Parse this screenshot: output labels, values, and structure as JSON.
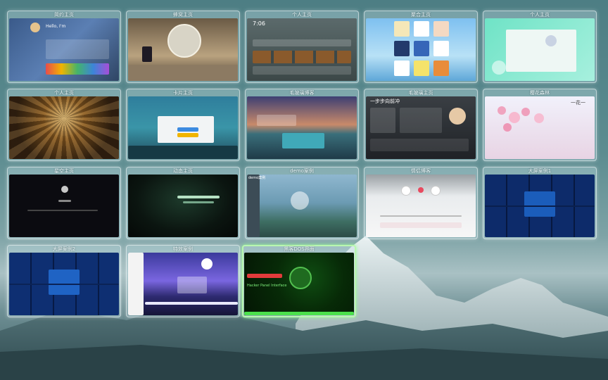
{
  "screen": {
    "cards": [
      {
        "title": "简约主页",
        "icon": "personal-homepage-preview",
        "accent": "#3c5c8f"
      },
      {
        "title": "蜂窝主页",
        "icon": "honeycomb-room-preview",
        "accent": "#8a7356"
      },
      {
        "title": "个人主页",
        "icon": "dashboard-preview",
        "accent": "#4b5b5c"
      },
      {
        "title": "聚合主页",
        "icon": "app-grid-preview",
        "accent": "#7cb7e0"
      },
      {
        "title": "个人主页",
        "icon": "profile-card-preview",
        "accent": "#7de0c8"
      },
      {
        "title": "个人主页",
        "icon": "cathedral-ceiling-preview",
        "accent": "#6b4a20"
      },
      {
        "title": "卡片主页",
        "icon": "forest-card-preview",
        "accent": "#2a5d7a"
      },
      {
        "title": "毛玻璃博客",
        "icon": "sunset-lake-preview",
        "accent": "#c7845f"
      },
      {
        "title": "毛玻璃主页",
        "icon": "glass-dashboard-preview",
        "accent": "#2d3338"
      },
      {
        "title": "樱花森林",
        "icon": "cherry-blossom-preview",
        "accent": "#f0c3d3"
      },
      {
        "title": "星空主页",
        "icon": "starry-night-preview",
        "accent": "#0c0c10"
      },
      {
        "title": "动态主页",
        "icon": "dynamic-grid-preview",
        "accent": "#0d1a14"
      },
      {
        "title": "demo案例",
        "icon": "demo-landscape-preview",
        "accent": "#6d9fb8"
      },
      {
        "title": "情侣博客",
        "icon": "couple-blog-preview",
        "accent": "#e9e9e9"
      },
      {
        "title": "大屏案例1",
        "icon": "bigscreen-dashboard-preview",
        "accent": "#0a1f4e"
      },
      {
        "title": "大屏案例2",
        "icon": "bigscreen-dashboard-preview",
        "accent": "#0b2356"
      },
      {
        "title": "特效案例",
        "icon": "synthwave-road-preview",
        "accent": "#5a4fc7"
      },
      {
        "title": "黑客DOS界面",
        "icon": "hacker-terminal-preview",
        "accent": "#0a2a0a"
      }
    ],
    "previews": {
      "simple_greeting": "Hello, I'm",
      "dashboard_time": "7:06",
      "glass_banner": "一步步向前冲",
      "cherry_text": "一花一",
      "demo_header": "demo案例",
      "dos_text": "Hacker Panel Interface"
    }
  }
}
